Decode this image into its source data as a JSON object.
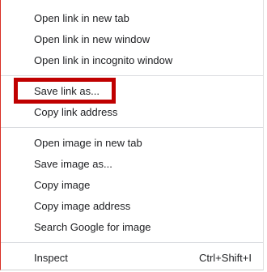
{
  "menu": {
    "group_open_links": [
      {
        "label": "Open link in new tab"
      },
      {
        "label": "Open link in new window"
      },
      {
        "label": "Open link in incognito window"
      }
    ],
    "group_save_links": [
      {
        "label": "Save link as..."
      },
      {
        "label": "Copy link address"
      }
    ],
    "group_image": [
      {
        "label": "Open image in new tab"
      },
      {
        "label": "Save image as..."
      },
      {
        "label": "Copy image"
      },
      {
        "label": "Copy image address"
      },
      {
        "label": "Search Google for image"
      }
    ],
    "group_dev": [
      {
        "label": "Inspect",
        "shortcut": "Ctrl+Shift+I"
      }
    ]
  },
  "colors": {
    "highlight": "#c00000",
    "separator": "#dadce0",
    "text": "#202124"
  }
}
